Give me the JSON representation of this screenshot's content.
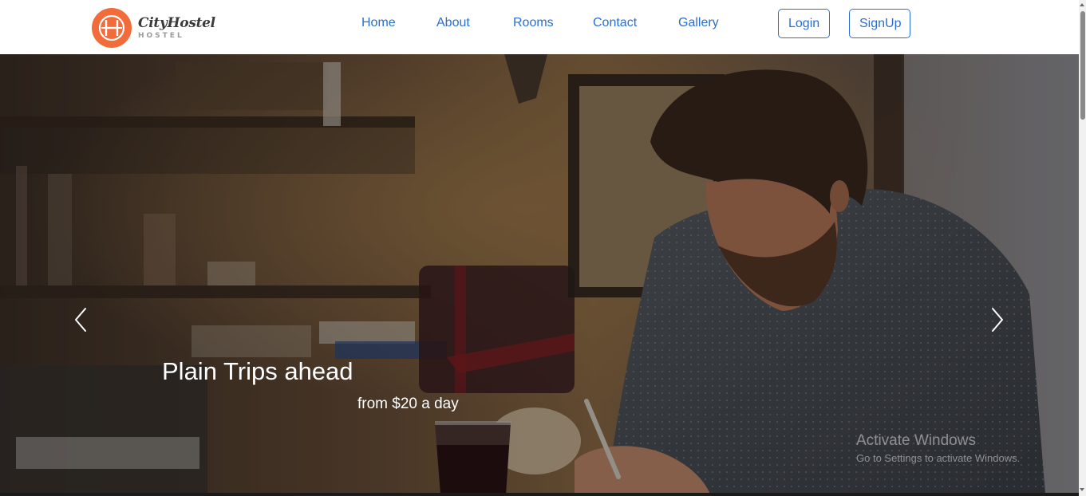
{
  "brand": {
    "name": "CityHostel",
    "subtitle": "HOSTEL",
    "logo_icon": "hostel-logo-icon",
    "accent_color": "#f26b3a"
  },
  "nav": {
    "links": [
      "Home",
      "About",
      "Rooms",
      "Contact",
      "Gallery"
    ],
    "login_label": "Login",
    "signup_label": "SignUp",
    "link_color": "#2a6ed1"
  },
  "carousel": {
    "title": "Plain Trips ahead",
    "subtitle": "from $20 a day",
    "prev_icon": "chevron-left-icon",
    "next_icon": "chevron-right-icon"
  },
  "watermark": {
    "title": "Activate Windows",
    "subtitle": "Go to Settings to activate Windows."
  }
}
